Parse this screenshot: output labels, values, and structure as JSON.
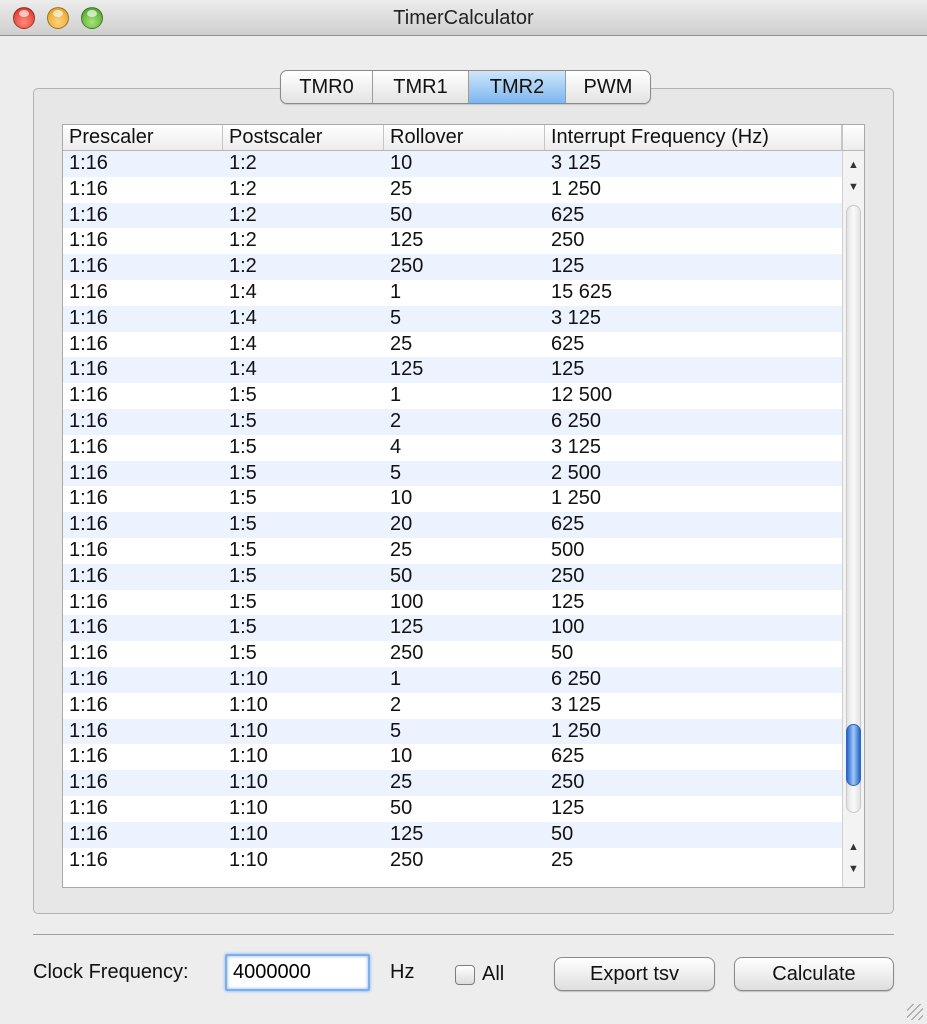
{
  "window": {
    "title": "TimerCalculator"
  },
  "tabs": [
    {
      "label": "TMR0",
      "active": false
    },
    {
      "label": "TMR1",
      "active": false
    },
    {
      "label": "TMR2",
      "active": true
    },
    {
      "label": "PWM",
      "active": false
    }
  ],
  "table": {
    "columns": [
      "Prescaler",
      "Postscaler",
      "Rollover",
      "Interrupt Frequency (Hz)"
    ],
    "rows": [
      [
        "1:16",
        "1:2",
        "10",
        "3 125"
      ],
      [
        "1:16",
        "1:2",
        "25",
        "1 250"
      ],
      [
        "1:16",
        "1:2",
        "50",
        "625"
      ],
      [
        "1:16",
        "1:2",
        "125",
        "250"
      ],
      [
        "1:16",
        "1:2",
        "250",
        "125"
      ],
      [
        "1:16",
        "1:4",
        "1",
        "15 625"
      ],
      [
        "1:16",
        "1:4",
        "5",
        "3 125"
      ],
      [
        "1:16",
        "1:4",
        "25",
        "625"
      ],
      [
        "1:16",
        "1:4",
        "125",
        "125"
      ],
      [
        "1:16",
        "1:5",
        "1",
        "12 500"
      ],
      [
        "1:16",
        "1:5",
        "2",
        "6 250"
      ],
      [
        "1:16",
        "1:5",
        "4",
        "3 125"
      ],
      [
        "1:16",
        "1:5",
        "5",
        "2 500"
      ],
      [
        "1:16",
        "1:5",
        "10",
        "1 250"
      ],
      [
        "1:16",
        "1:5",
        "20",
        "625"
      ],
      [
        "1:16",
        "1:5",
        "25",
        "500"
      ],
      [
        "1:16",
        "1:5",
        "50",
        "250"
      ],
      [
        "1:16",
        "1:5",
        "100",
        "125"
      ],
      [
        "1:16",
        "1:5",
        "125",
        "100"
      ],
      [
        "1:16",
        "1:5",
        "250",
        "50"
      ],
      [
        "1:16",
        "1:10",
        "1",
        "6 250"
      ],
      [
        "1:16",
        "1:10",
        "2",
        "3 125"
      ],
      [
        "1:16",
        "1:10",
        "5",
        "1 250"
      ],
      [
        "1:16",
        "1:10",
        "10",
        "625"
      ],
      [
        "1:16",
        "1:10",
        "25",
        "250"
      ],
      [
        "1:16",
        "1:10",
        "50",
        "125"
      ],
      [
        "1:16",
        "1:10",
        "125",
        "50"
      ],
      [
        "1:16",
        "1:10",
        "250",
        "25"
      ]
    ],
    "scroll_position_fraction": 0.95
  },
  "footer": {
    "clock_label": "Clock Frequency:",
    "clock_value": "4000000",
    "unit_label": "Hz",
    "all_label": "All",
    "all_checked": false,
    "export_label": "Export tsv",
    "calculate_label": "Calculate"
  },
  "icons": {
    "scroll_up": "scroll-up-arrow",
    "scroll_down": "scroll-down-arrow"
  }
}
